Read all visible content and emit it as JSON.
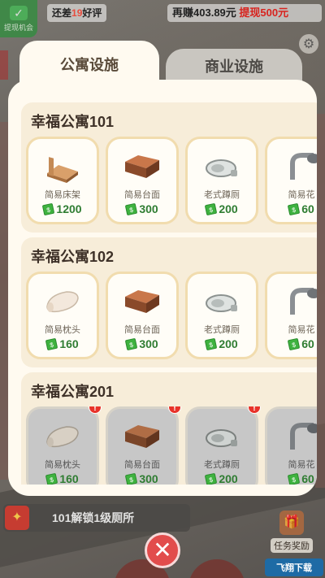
{
  "topbar": {
    "left_button_label": "提现机会",
    "left_button_icon": "check-icon",
    "remaining_prefix": "还差",
    "remaining_count": "19",
    "remaining_suffix": "好评",
    "earn_prefix": "再赚",
    "earn_amount": "403.89元",
    "withdraw_label": "提现500元"
  },
  "tabs": [
    {
      "label": "公寓设施",
      "active": true
    },
    {
      "label": "商业设施",
      "active": false
    }
  ],
  "sections": [
    {
      "title": "幸福公寓101",
      "items": [
        {
          "name": "简易床架",
          "price": "1200",
          "icon": "bed-frame-icon",
          "locked": false
        },
        {
          "name": "简易台面",
          "price": "300",
          "icon": "counter-icon",
          "locked": false
        },
        {
          "name": "老式蹲厕",
          "price": "200",
          "icon": "squat-toilet-icon",
          "locked": false
        },
        {
          "name": "简易花",
          "price": "60",
          "icon": "shower-icon",
          "locked": false
        }
      ]
    },
    {
      "title": "幸福公寓102",
      "items": [
        {
          "name": "简易枕头",
          "price": "160",
          "icon": "pillow-icon",
          "locked": false
        },
        {
          "name": "简易台面",
          "price": "300",
          "icon": "counter-icon",
          "locked": false
        },
        {
          "name": "老式蹲厕",
          "price": "200",
          "icon": "squat-toilet-icon",
          "locked": false
        },
        {
          "name": "简易花",
          "price": "60",
          "icon": "shower-icon",
          "locked": false
        }
      ]
    },
    {
      "title": "幸福公寓201",
      "items": [
        {
          "name": "简易枕头",
          "price": "160",
          "icon": "pillow-icon",
          "locked": true
        },
        {
          "name": "简易台面",
          "price": "300",
          "icon": "counter-icon",
          "locked": true
        },
        {
          "name": "老式蹲厕",
          "price": "200",
          "icon": "squat-toilet-icon",
          "locked": true
        },
        {
          "name": "简易花",
          "price": "60",
          "icon": "shower-icon",
          "locked": true
        }
      ]
    }
  ],
  "bottom": {
    "unlock_text": "101解锁1级厕所",
    "task_label": "任务奖励",
    "close_icon": "close-icon",
    "watermark": "飞翔下载"
  },
  "colors": {
    "panel_bg": "#fffaf0",
    "section_bg": "#f7edd9",
    "card_border": "#f1dcae",
    "price_green": "#2f7d32",
    "withdraw_red": "#d8231e",
    "close_red": "#e24c4c"
  }
}
